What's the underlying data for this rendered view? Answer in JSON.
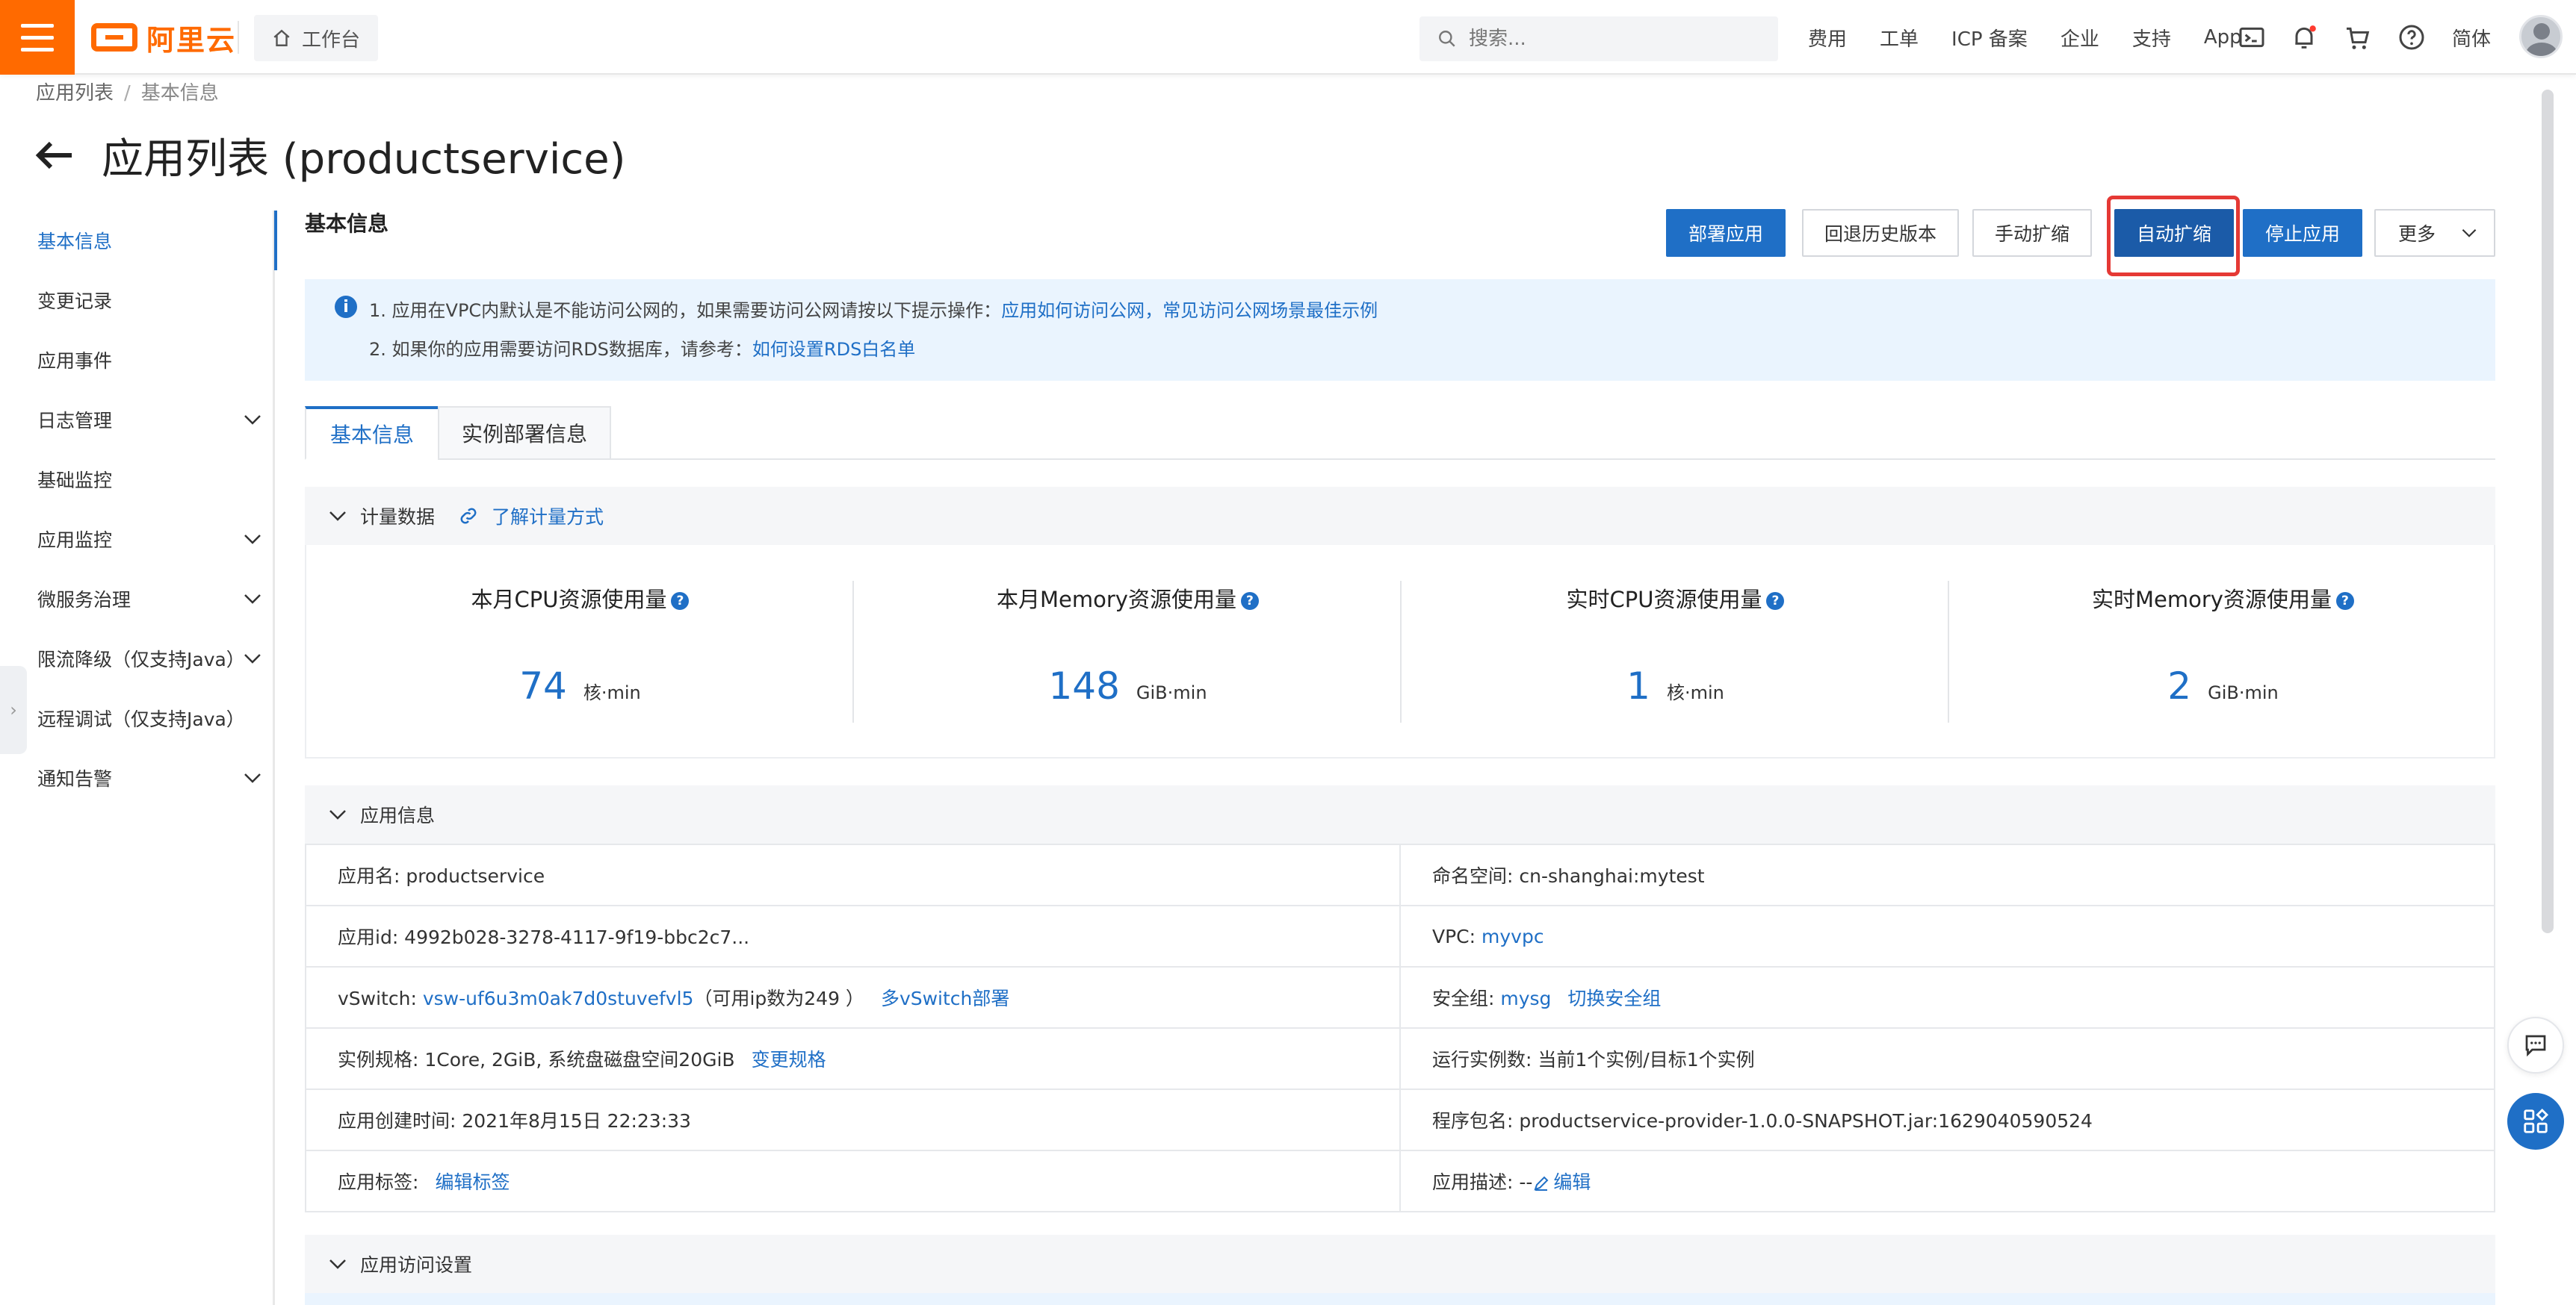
{
  "topbar": {
    "logo_text": "阿里云",
    "workbench": "工作台",
    "search_placeholder": "搜索...",
    "links": [
      "费用",
      "工单",
      "ICP 备案",
      "企业",
      "支持",
      "App"
    ],
    "lang": "简体",
    "accent": "#ff6a00"
  },
  "breadcrumb": {
    "parent": "应用列表",
    "sep": "/",
    "current": "基本信息"
  },
  "page": {
    "title": "应用列表 (productservice)",
    "section_title": "基本信息"
  },
  "sidebar": {
    "items": [
      {
        "label": "基本信息",
        "active": true
      },
      {
        "label": "变更记录"
      },
      {
        "label": "应用事件"
      },
      {
        "label": "日志管理",
        "expand": true
      },
      {
        "label": "基础监控"
      },
      {
        "label": "应用监控",
        "expand": true
      },
      {
        "label": "微服务治理",
        "expand": true
      },
      {
        "label": "限流降级（仅支持Java）",
        "expand": true
      },
      {
        "label": "远程调试（仅支持Java）"
      },
      {
        "label": "通知告警",
        "expand": true
      }
    ]
  },
  "actions": {
    "deploy": "部署应用",
    "rollback": "回退历史版本",
    "manual_scale": "手动扩缩",
    "auto_scale": "自动扩缩",
    "stop": "停止应用",
    "more": "更多"
  },
  "notice": {
    "line1_text": "1. 应用在VPC内默认是不能访问公网的，如果需要访问公网请按以下提示操作：",
    "line1_link1": "应用如何访问公网",
    "line1_comma": "，",
    "line1_link2": "常见访问公网场景最佳示例",
    "line2_text": "2. 如果你的应用需要访问RDS数据库，请参考：",
    "line2_link": "如何设置RDS白名单"
  },
  "tabs": [
    "基本信息",
    "实例部署信息"
  ],
  "metering": {
    "title": "计量数据",
    "link": "了解计量方式",
    "metrics": [
      {
        "label": "本月CPU资源使用量",
        "value": "74",
        "unit": "核·min"
      },
      {
        "label": "本月Memory资源使用量",
        "value": "148",
        "unit": "GiB·min"
      },
      {
        "label": "实时CPU资源使用量",
        "value": "1",
        "unit": "核·min"
      },
      {
        "label": "实时Memory资源使用量",
        "value": "2",
        "unit": "GiB·min"
      }
    ]
  },
  "appinfo": {
    "title": "应用信息",
    "app_name": "应用名: productservice",
    "namespace": "命名空间: cn-shanghai:mytest",
    "app_id": "应用id: 4992b028-3278-4117-9f19-bbc2c7...",
    "vpc_label": "VPC: ",
    "vpc_value": "myvpc",
    "vswitch_label": "vSwitch: ",
    "vswitch_value": "vsw-uf6u3m0ak7d0stuvefvl5",
    "vswitch_ip": "（可用ip数为249 ）",
    "vswitch_link": "多vSwitch部署",
    "sg_label": "安全组: ",
    "sg_value": "mysg",
    "sg_link": "切换安全组",
    "spec": "实例规格: 1Core, 2GiB, 系统盘磁盘空间20GiB",
    "spec_link": "变更规格",
    "instances": "运行实例数: 当前1个实例/目标1个实例",
    "created": "应用创建时间: 2021年8月15日 22:23:33",
    "package": "程序包名: productservice-provider-1.0.0-SNAPSHOT.jar:1629040590524",
    "tags_label": "应用标签:",
    "tags_link": "编辑标签",
    "desc_label": "应用描述: --",
    "desc_link": "编辑"
  },
  "access": {
    "title": "应用访问设置"
  }
}
